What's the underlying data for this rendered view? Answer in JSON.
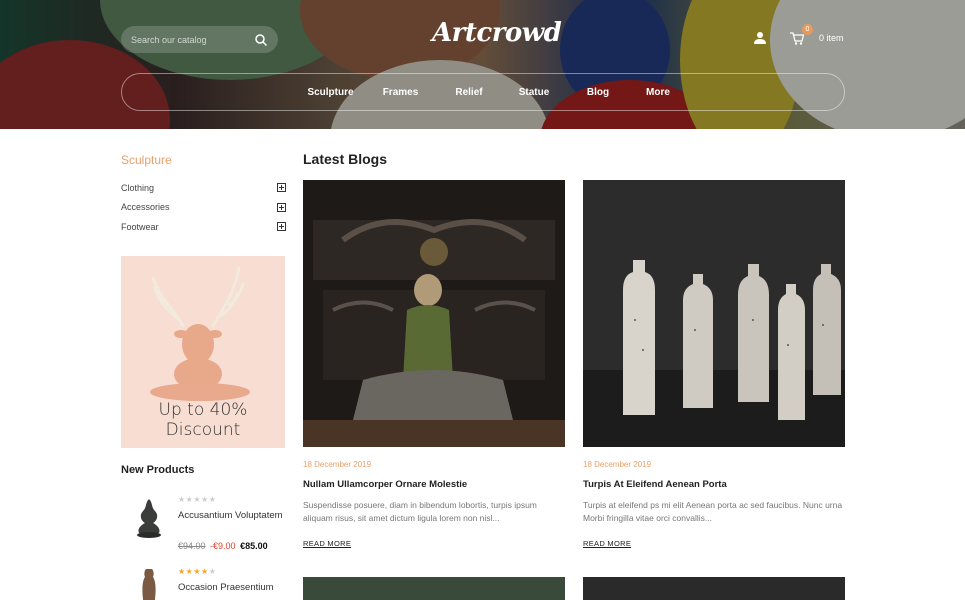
{
  "header": {
    "search_placeholder": "Search our catalog",
    "logo": "Artcrowd",
    "cart_count": "0",
    "cart_label": "0 item"
  },
  "nav": {
    "items": [
      "Sculpture",
      "Frames",
      "Relief",
      "Statue",
      "Blog",
      "More"
    ]
  },
  "sidebar": {
    "category_title": "Sculpture",
    "categories": [
      "Clothing",
      "Accessories",
      "Footwear"
    ],
    "promo_text": "Up to 40% Discount",
    "new_products_title": "New Products",
    "products": [
      {
        "name": "Accusantium Voluptatem",
        "rating": 0,
        "old_price": "€94.00",
        "discount": "-€9.00",
        "price": "€85.00"
      },
      {
        "name": "Occasion Praesentium",
        "rating": 4
      }
    ]
  },
  "blogs": {
    "title": "Latest Blogs",
    "posts": [
      {
        "date": "18 December 2019",
        "title": "Nullam Ullamcorper Ornare Molestie",
        "excerpt": "Suspendisse posuere, diam in bibendum lobortis, turpis ipsum aliquam risus, sit amet dictum ligula lorem non nisl...",
        "read_more": "READ MORE"
      },
      {
        "date": "18 December 2019",
        "title": "Turpis At Eleifend Aenean Porta",
        "excerpt": "Turpis at eleifend ps mi elit Aenean porta ac sed faucibus. Nunc urna Morbi fringilla vitae orci convallis...",
        "read_more": "READ MORE"
      }
    ]
  },
  "colors": {
    "accent": "#e8a06a",
    "discount": "#e0402a",
    "star": "#f5a623",
    "promo_bg": "#f7ddd2"
  }
}
